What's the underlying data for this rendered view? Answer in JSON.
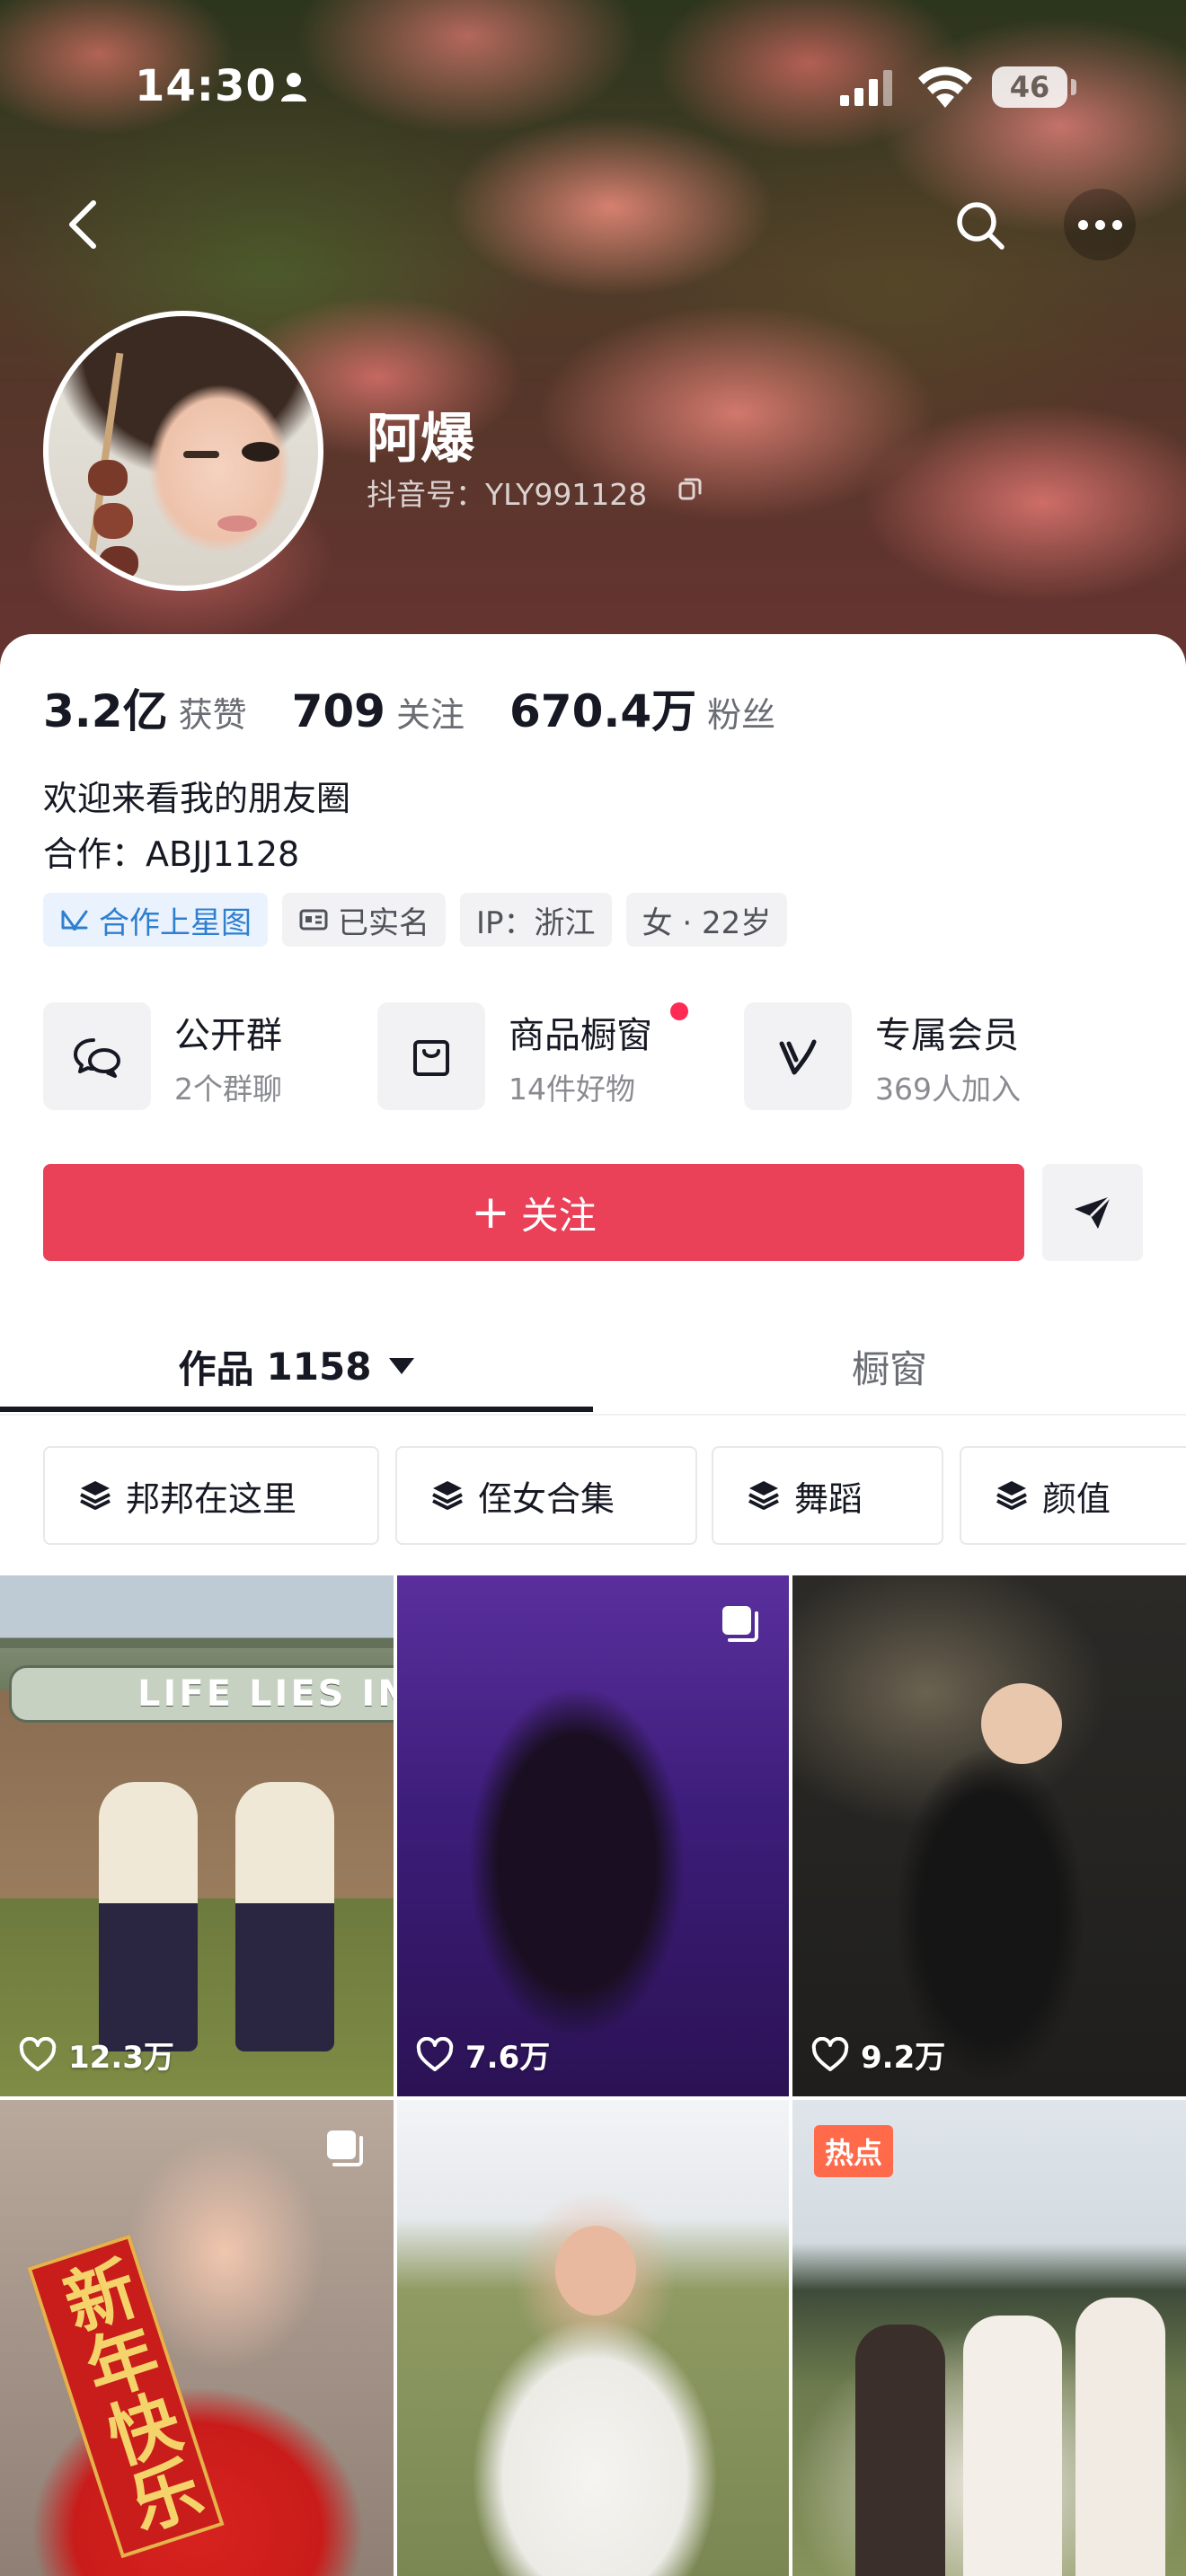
{
  "status_bar": {
    "time": "14:30",
    "battery": "46"
  },
  "profile": {
    "name": "阿爆",
    "douyin_id": "抖音号：YLY991128"
  },
  "stats": [
    {
      "value": "3.2亿",
      "label": "获赞"
    },
    {
      "value": "709",
      "label": "关注"
    },
    {
      "value": "670.4万",
      "label": "粉丝"
    }
  ],
  "bio": {
    "line1": "欢迎来看我的朋友圈",
    "line2": "合作：ABJJ1128"
  },
  "tags": [
    {
      "label": "合作上星图",
      "icon": "star-map-icon"
    },
    {
      "label": "已实名",
      "icon": "id-card-icon"
    },
    {
      "label": "IP：浙江"
    },
    {
      "label": "女 · 22岁"
    }
  ],
  "features": [
    {
      "title": "公开群",
      "sub": "2个群聊",
      "icon": "chat-bubbles-icon"
    },
    {
      "title": "商品橱窗",
      "sub": "14件好物",
      "icon": "shopping-bag-icon",
      "has_dot": true
    },
    {
      "title": "专属会员",
      "sub": "369人加入",
      "icon": "vip-v-icon"
    }
  ],
  "actions": {
    "follow_plus": "+",
    "follow_label": "关注"
  },
  "tabs": {
    "works_label": "作品",
    "works_count": "1158",
    "window_label": "橱窗"
  },
  "collections": [
    {
      "label": "邦邦在这里"
    },
    {
      "label": "侄女合集"
    },
    {
      "label": "舞蹈"
    },
    {
      "label": "颜值"
    }
  ],
  "grid": [
    {
      "likes": "12.3万",
      "multi": false,
      "sign_text": "LIFE LIES IN"
    },
    {
      "likes": "7.6万",
      "multi": true
    },
    {
      "likes": "9.2万",
      "multi": false
    },
    {
      "multi": true,
      "banner_text": "新年快乐"
    },
    {
      "multi": false
    },
    {
      "hot_label": "热点",
      "multi": false
    }
  ],
  "colors": {
    "follow": "#ea4058",
    "accent_red": "#fe2c55",
    "tag_blue": "#2f7fd1",
    "hot": "#fe6a4a"
  }
}
